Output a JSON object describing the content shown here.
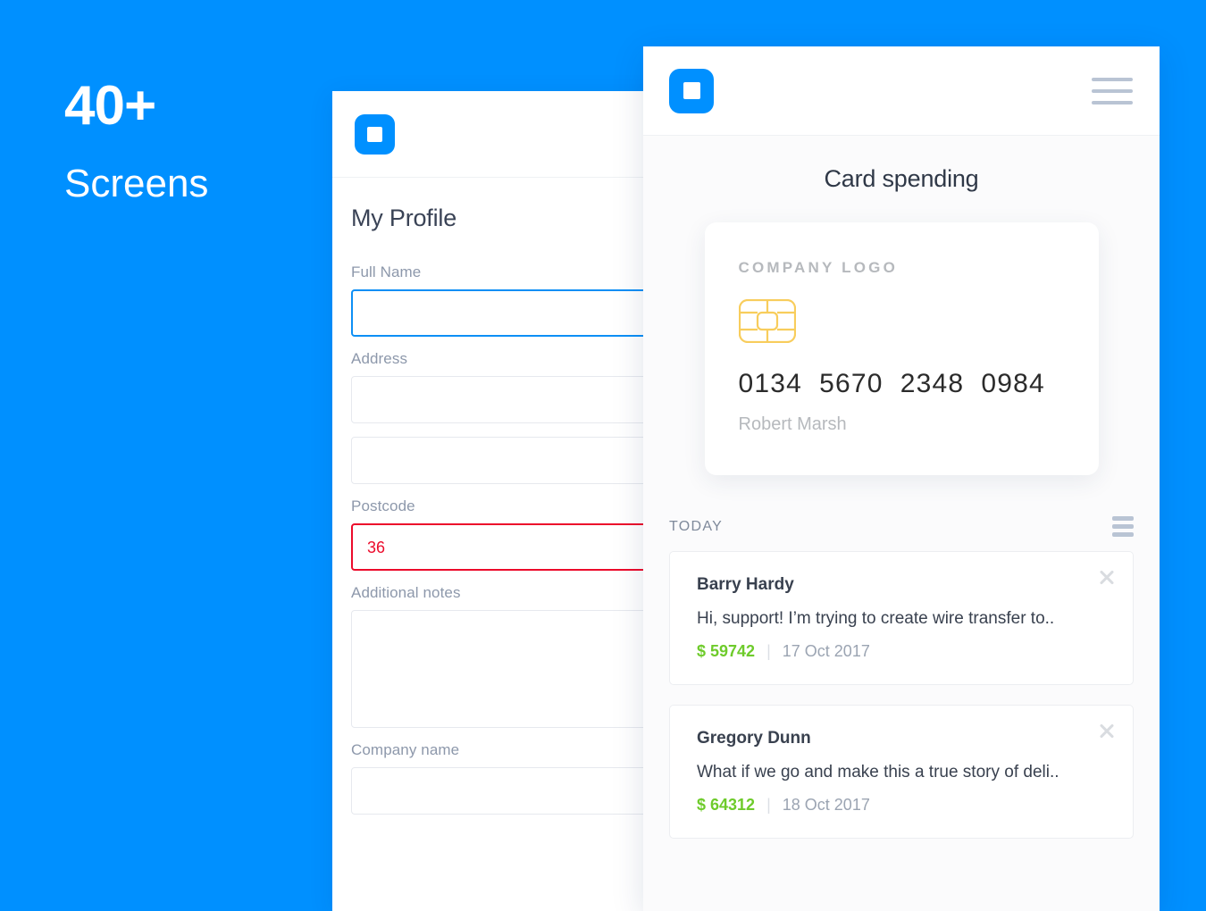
{
  "promo": {
    "headline": "40+",
    "subtitle": "Screens",
    "background_color": "#0090ff"
  },
  "profile_panel": {
    "logo_icon": "app-logo-square-icon",
    "title": "My Profile",
    "fields": [
      {
        "label": "Full Name",
        "value": "",
        "state": "focused",
        "type": "input"
      },
      {
        "label": "Address",
        "value": "",
        "state": "default",
        "type": "input"
      },
      {
        "label": "",
        "value": "",
        "state": "default",
        "type": "input"
      },
      {
        "label": "Postcode",
        "value": "36",
        "state": "error",
        "type": "input"
      },
      {
        "label": "Additional notes",
        "value": "",
        "state": "default",
        "type": "textarea"
      },
      {
        "label": "Company name",
        "value": "",
        "state": "default",
        "type": "input"
      }
    ],
    "focus_border_color": "#0d8ff5",
    "error_border_color": "#ec0b2b"
  },
  "spending_panel": {
    "logo_icon": "app-logo-square-icon",
    "menu_icon": "hamburger-menu-icon",
    "title": "Card spending",
    "card": {
      "company_logo_text": "COMPANY LOGO",
      "chip_icon": "emv-chip-icon",
      "chip_color": "#f8cd5c",
      "number": "0134  5670  2348  0984",
      "holder": "Robert Marsh"
    },
    "section_label": "TODAY",
    "filter_icon": "list-filter-icon",
    "messages": [
      {
        "name": "Barry Hardy",
        "preview": "Hi, support! I’m trying to create wire transfer to..",
        "amount": "$ 59742",
        "separator": "|",
        "date": "17 Oct 2017",
        "close_icon": "close-icon"
      },
      {
        "name": "Gregory Dunn",
        "preview": "What if we go and make this a true story of deli..",
        "amount": "$ 64312",
        "separator": "|",
        "date": "18 Oct 2017",
        "close_icon": "close-icon"
      }
    ],
    "amount_color": "#6ecb2b"
  }
}
